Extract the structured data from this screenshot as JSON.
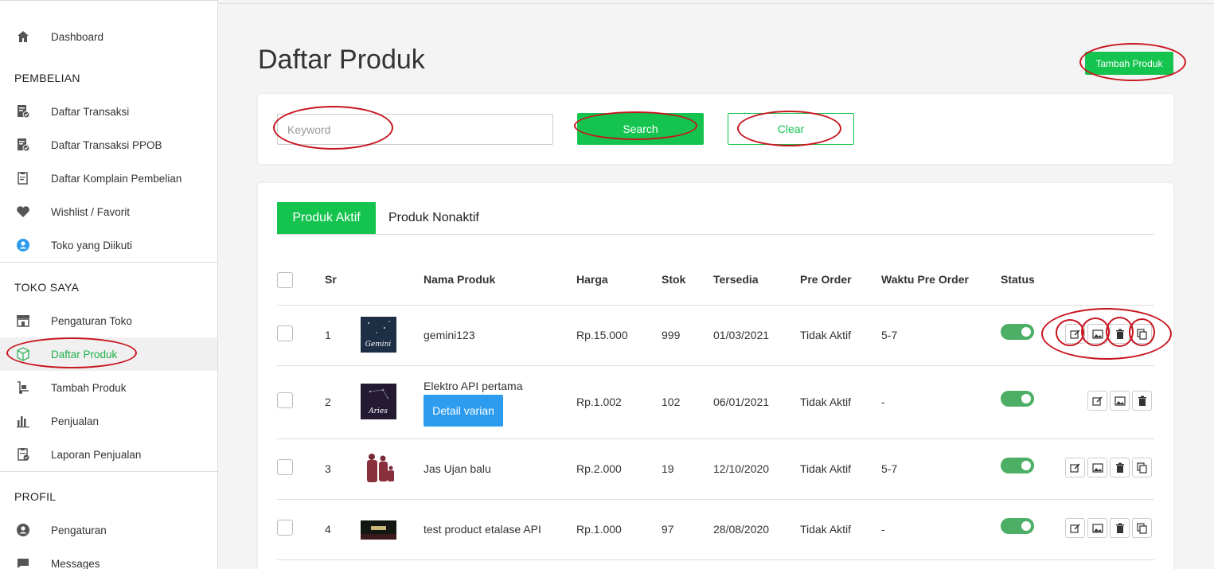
{
  "sidebar": {
    "dashboard": "Dashboard",
    "pembelian_head": "PEMBELIAN",
    "daftar_transaksi": "Daftar Transaksi",
    "daftar_transaksi_ppob": "Daftar Transaksi PPOB",
    "daftar_komplain": "Daftar Komplain Pembelian",
    "wishlist": "Wishlist / Favorit",
    "toko_diikuti": "Toko yang Diikuti",
    "toko_saya_head": "TOKO SAYA",
    "pengaturan_toko": "Pengaturan Toko",
    "daftar_produk": "Daftar Produk",
    "tambah_produk": "Tambah Produk",
    "penjualan": "Penjualan",
    "laporan_penjualan": "Laporan Penjualan",
    "profil_head": "PROFIL",
    "pengaturan": "Pengaturan",
    "messages": "Messages"
  },
  "header": {
    "title": "Daftar Produk",
    "add_button": "Tambah Produk"
  },
  "search": {
    "placeholder": "Keyword",
    "search_button": "Search",
    "clear_button": "Clear"
  },
  "tabs": {
    "active": "Produk Aktif",
    "inactive": "Produk Nonaktif"
  },
  "table": {
    "headers": {
      "sr": "Sr",
      "nama": "Nama Produk",
      "harga": "Harga",
      "stok": "Stok",
      "tersedia": "Tersedia",
      "pre_order": "Pre Order",
      "waktu": "Waktu Pre Order",
      "status": "Status"
    },
    "rows": [
      {
        "sr": "1",
        "nama": "gemini123",
        "harga": "Rp.15.000",
        "stok": "999",
        "tersedia": "01/03/2021",
        "pre_order": "Tidak Aktif",
        "waktu": "5-7",
        "thumb_label": "Gemini"
      },
      {
        "sr": "2",
        "nama": "Elektro API pertama",
        "harga": "Rp.1.002",
        "stok": "102",
        "tersedia": "06/01/2021",
        "pre_order": "Tidak Aktif",
        "waktu": "-",
        "variant_button": "Detail varian",
        "thumb_label": "Aries"
      },
      {
        "sr": "3",
        "nama": "Jas Ujan balu",
        "harga": "Rp.2.000",
        "stok": "19",
        "tersedia": "12/10/2020",
        "pre_order": "Tidak Aktif",
        "waktu": "5-7"
      },
      {
        "sr": "4",
        "nama": "test product etalase API",
        "harga": "Rp.1.000",
        "stok": "97",
        "tersedia": "28/08/2020",
        "pre_order": "Tidak Aktif",
        "waktu": "-"
      }
    ]
  },
  "colors": {
    "accent": "#14c44e",
    "variant": "#2d9cef",
    "annotation": "#c8141e"
  }
}
